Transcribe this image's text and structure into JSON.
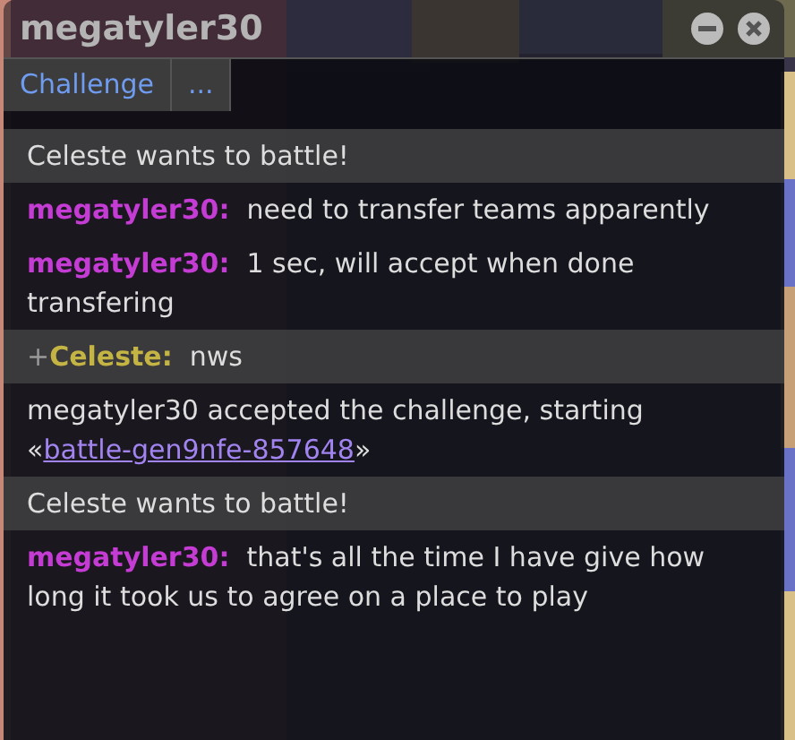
{
  "window": {
    "title": "megatyler30"
  },
  "buttons": [
    {
      "label": "Challenge"
    },
    {
      "label": "..."
    }
  ],
  "messages": [
    {
      "kind": "notice",
      "text": "Celeste wants to battle!"
    },
    {
      "kind": "chat",
      "user": "megatyler30:",
      "color": "#c43cd4",
      "text": "need to transfer teams apparently",
      "highlighted": false
    },
    {
      "kind": "chat",
      "user": "megatyler30:",
      "color": "#c43cd4",
      "text": "1 sec, will accept when done transfering",
      "highlighted": false
    },
    {
      "kind": "chat",
      "rank": "+",
      "user": "Celeste:",
      "color": "#c4b444",
      "text": "nws",
      "highlighted": true
    },
    {
      "kind": "system",
      "text": "megatyler30 accepted the challenge, starting «",
      "link": "battle-gen9nfe-857648",
      "after": "»"
    },
    {
      "kind": "notice",
      "text": "Celeste wants to battle!"
    },
    {
      "kind": "chat",
      "user": "megatyler30:",
      "color": "#c43cd4",
      "text": "that's all the time I have give how long it took us to agree on a place to play",
      "highlighted": false
    }
  ]
}
